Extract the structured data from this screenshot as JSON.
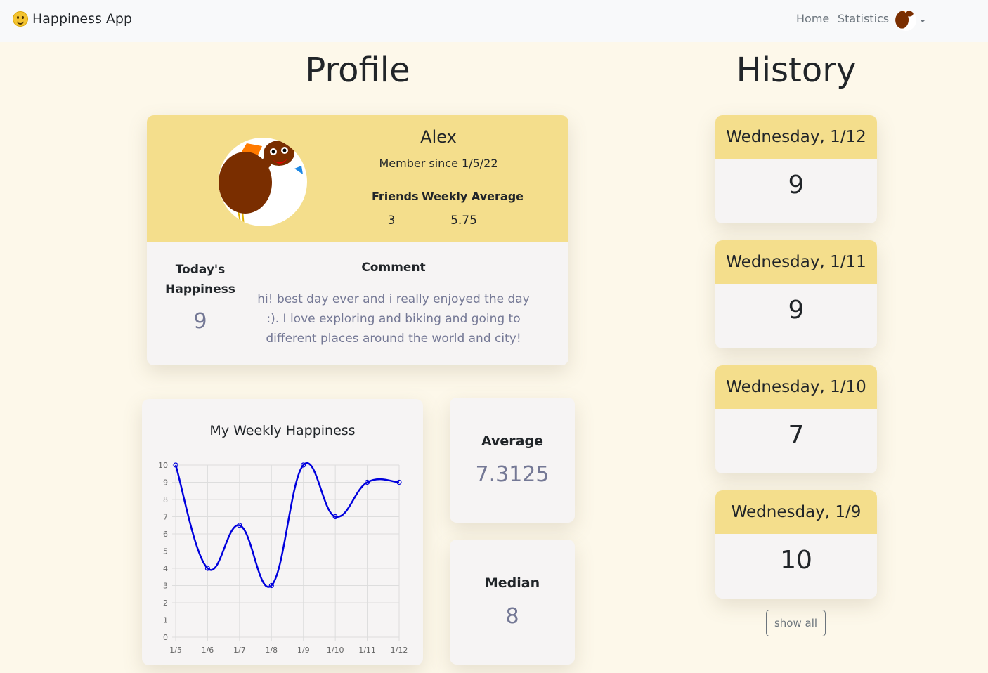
{
  "app": {
    "title": "Happiness App"
  },
  "nav": {
    "home": "Home",
    "statistics": "Statistics"
  },
  "profile": {
    "heading": "Profile",
    "name": "Alex",
    "member_since": "Member since 1/5/22",
    "friends_label": "Friends",
    "friends_value": "3",
    "weekly_avg_label": "Weekly Average",
    "weekly_avg_value": "5.75",
    "today_label": "Today's Happiness",
    "today_value": "9",
    "comment_label": "Comment",
    "comment_text": "hi! best day ever and i really enjoyed the day :). I love exploring and biking and going to different places around the world and city!"
  },
  "stats": {
    "average_label": "Average",
    "average_value": "7.3125",
    "median_label": "Median",
    "median_value": "8"
  },
  "history": {
    "heading": "History",
    "items": [
      {
        "date": "Wednesday, 1/12",
        "value": "9"
      },
      {
        "date": "Wednesday, 1/11",
        "value": "9"
      },
      {
        "date": "Wednesday, 1/10",
        "value": "7"
      },
      {
        "date": "Wednesday, 1/9",
        "value": "10"
      }
    ],
    "show_all": "show all"
  },
  "colors": {
    "accent": "#f4de8c",
    "line": "#0000dd",
    "background": "#fdf8ea"
  },
  "chart_data": {
    "type": "line",
    "title": "My Weekly Happiness",
    "categories": [
      "1/5",
      "1/6",
      "1/7",
      "1/8",
      "1/9",
      "1/10",
      "1/11",
      "1/12"
    ],
    "values": [
      10,
      4,
      6.5,
      3,
      10,
      7,
      9,
      9
    ],
    "ylim": [
      0,
      10
    ],
    "yticks": [
      0,
      1,
      2,
      3,
      4,
      5,
      6,
      7,
      8,
      9,
      10
    ],
    "grid": true,
    "color": "#0000dd"
  }
}
